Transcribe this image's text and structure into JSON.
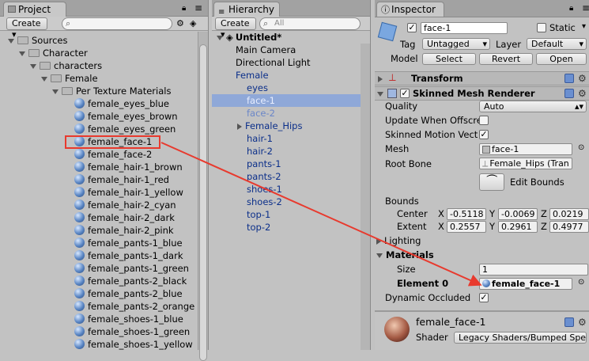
{
  "project": {
    "tab_title": "Project",
    "create_label": "Create",
    "tree": [
      "Sources",
      "Character",
      "characters",
      "Female",
      "Per Texture Materials"
    ],
    "materials": [
      "female_eyes_blue",
      "female_eyes_brown",
      "female_eyes_green",
      "female_face-1",
      "female_face-2",
      "female_hair-1_brown",
      "female_hair-1_red",
      "female_hair-1_yellow",
      "female_hair-2_cyan",
      "female_hair-2_dark",
      "female_hair-2_pink",
      "female_pants-1_blue",
      "female_pants-1_dark",
      "female_pants-1_green",
      "female_pants-2_black",
      "female_pants-2_blue",
      "female_pants-2_orange",
      "female_shoes-1_blue",
      "female_shoes-1_green",
      "female_shoes-1_yellow"
    ],
    "highlighted": "female_face-1"
  },
  "hierarchy": {
    "tab_title": "Hierarchy",
    "create_label": "Create",
    "search_placeholder": "All",
    "scene": "Untitled*",
    "items": [
      {
        "label": "Main Camera",
        "color": "black",
        "indent": 0
      },
      {
        "label": "Directional Light",
        "color": "black",
        "indent": 0
      },
      {
        "label": "Female",
        "color": "blue",
        "indent": 0
      },
      {
        "label": "eyes",
        "color": "blue",
        "indent": 1
      },
      {
        "label": "face-1",
        "color": "blue",
        "indent": 1,
        "selected": true
      },
      {
        "label": "face-2",
        "color": "blue",
        "indent": 1
      },
      {
        "label": "Female_Hips",
        "color": "blue",
        "indent": 1,
        "collapsed": true
      },
      {
        "label": "hair-1",
        "color": "blue",
        "indent": 1
      },
      {
        "label": "hair-2",
        "color": "blue",
        "indent": 1
      },
      {
        "label": "pants-1",
        "color": "blue",
        "indent": 1
      },
      {
        "label": "pants-2",
        "color": "blue",
        "indent": 1
      },
      {
        "label": "shoes-1",
        "color": "blue",
        "indent": 1
      },
      {
        "label": "shoes-2",
        "color": "blue",
        "indent": 1
      },
      {
        "label": "top-1",
        "color": "blue",
        "indent": 1
      },
      {
        "label": "top-2",
        "color": "blue",
        "indent": 1
      }
    ]
  },
  "inspector": {
    "tab_title": "Inspector",
    "object_name": "face-1",
    "static_label": "Static",
    "tag_label": "Tag",
    "tag_value": "Untagged",
    "layer_label": "Layer",
    "layer_value": "Default",
    "model_label": "Model",
    "select_label": "Select",
    "revert_label": "Revert",
    "open_label": "Open",
    "transform_label": "Transform",
    "smr_label": "Skinned Mesh Renderer",
    "quality_label": "Quality",
    "quality_value": "Auto",
    "update_offscreen_label": "Update When Offscre",
    "skinned_motion_label": "Skinned Motion Vect",
    "mesh_label": "Mesh",
    "mesh_value": "face-1",
    "root_bone_label": "Root Bone",
    "root_bone_value": "Female_Hips (Tran",
    "edit_bounds_label": "Edit Bounds",
    "bounds_label": "Bounds",
    "center_label": "Center",
    "center_x": "-0.5118",
    "center_y": "-0.0069",
    "center_z": "0.0219",
    "extent_label": "Extent",
    "extent_x": "0.2557",
    "extent_y": "0.2961",
    "extent_z": "0.4977",
    "x_label": "X",
    "y_label": "Y",
    "z_label": "Z",
    "lighting_label": "Lighting",
    "materials_label": "Materials",
    "size_label": "Size",
    "size_value": "1",
    "element0_label": "Element 0",
    "element0_value": "female_face-1",
    "dynamic_occluded_label": "Dynamic Occluded",
    "material_name": "female_face-1",
    "shader_label": "Shader",
    "shader_value": "Legacy Shaders/Bumped Spe"
  },
  "colors": {
    "annotation": "#e83a2e",
    "selection": "#8fa8d8",
    "link_blue": "#0b2f8a"
  }
}
